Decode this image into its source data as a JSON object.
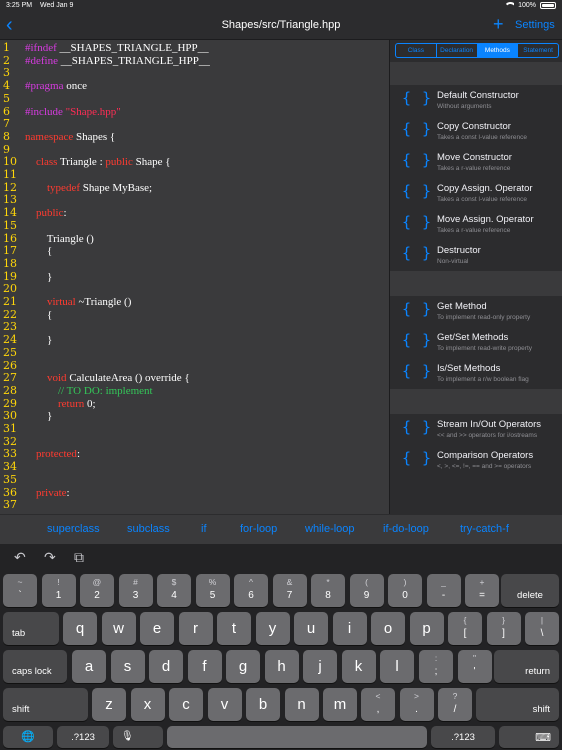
{
  "status": {
    "time": "3:25 PM",
    "date": "Wed Jan 9",
    "battery": "100%"
  },
  "nav": {
    "back_icon": "chevron-left-icon",
    "title": "Shapes/src/Triangle.hpp",
    "plus": "+",
    "settings": "Settings"
  },
  "editor": {
    "line_numbers": [
      "1",
      "2",
      "3",
      "4",
      "5",
      "6",
      "7",
      "8",
      "9",
      "10",
      "11",
      "12",
      "13",
      "14",
      "15",
      "16",
      "17",
      "18",
      "19",
      "20",
      "21",
      "22",
      "23",
      "24",
      "25",
      "26",
      "27",
      "28",
      "29",
      "30",
      "31",
      "32",
      "33",
      "34",
      "35",
      "36",
      "37"
    ],
    "lines": [
      [
        {
          "t": "#ifndef",
          "c": "kw"
        },
        {
          "t": " __SHAPES_TRIANGLE_HPP__",
          "c": ""
        }
      ],
      [
        {
          "t": "#define",
          "c": "kw"
        },
        {
          "t": " __SHAPES_TRIANGLE_HPP__",
          "c": ""
        }
      ],
      [],
      [
        {
          "t": "#pragma",
          "c": "kw"
        },
        {
          "t": " once",
          "c": ""
        }
      ],
      [],
      [
        {
          "t": "#include",
          "c": "kw"
        },
        {
          "t": " \"Shape.hpp\"",
          "c": "str"
        }
      ],
      [],
      [
        {
          "t": "namespace",
          "c": "red"
        },
        {
          "t": " Shapes {",
          "c": ""
        }
      ],
      [],
      [
        {
          "t": "    class",
          "c": "red"
        },
        {
          "t": " Triangle : ",
          "c": ""
        },
        {
          "t": "public",
          "c": "red"
        },
        {
          "t": " Shape {",
          "c": ""
        }
      ],
      [],
      [
        {
          "t": "        typedef",
          "c": "red"
        },
        {
          "t": " Shape MyBase;",
          "c": ""
        }
      ],
      [],
      [
        {
          "t": "    public",
          "c": "red"
        },
        {
          "t": ":",
          "c": ""
        }
      ],
      [],
      [
        {
          "t": "        Triangle ()",
          "c": ""
        }
      ],
      [
        {
          "t": "        {",
          "c": ""
        }
      ],
      [],
      [
        {
          "t": "        }",
          "c": ""
        }
      ],
      [],
      [
        {
          "t": "        virtual",
          "c": "red"
        },
        {
          "t": " ~Triangle ()",
          "c": ""
        }
      ],
      [
        {
          "t": "        {",
          "c": ""
        }
      ],
      [],
      [
        {
          "t": "        }",
          "c": ""
        }
      ],
      [],
      [],
      [
        {
          "t": "        void",
          "c": "red"
        },
        {
          "t": " CalculateArea () override {",
          "c": ""
        }
      ],
      [
        {
          "t": "            // TO DO: implement",
          "c": "grn"
        }
      ],
      [
        {
          "t": "            return",
          "c": "red"
        },
        {
          "t": " 0;",
          "c": ""
        }
      ],
      [
        {
          "t": "        }",
          "c": ""
        }
      ],
      [],
      [],
      [
        {
          "t": "    protected",
          "c": "red"
        },
        {
          "t": ":",
          "c": ""
        }
      ],
      [],
      [],
      [
        {
          "t": "    private",
          "c": "red"
        },
        {
          "t": ":",
          "c": ""
        }
      ]
    ]
  },
  "panel": {
    "tabs": [
      {
        "label": "Class",
        "active": false
      },
      {
        "label": "Declaration",
        "active": false
      },
      {
        "label": "Methods",
        "active": true
      },
      {
        "label": "Statement",
        "active": false
      }
    ],
    "brace_icon": "{ }",
    "groups": [
      [
        {
          "title": "Default Constructor",
          "subtitle": "Without arguments"
        },
        {
          "title": "Copy Constructor",
          "subtitle": "Takes a const l-value reference"
        },
        {
          "title": "Move Constructor",
          "subtitle": "Takes a r-value reference"
        },
        {
          "title": "Copy Assign. Operator",
          "subtitle": "Takes a const l-value reference"
        },
        {
          "title": "Move Assign. Operator",
          "subtitle": "Takes a r-value reference"
        },
        {
          "title": "Destructor",
          "subtitle": "Non-virtual"
        }
      ],
      [
        {
          "title": "Get Method",
          "subtitle": "To implement read-only property"
        },
        {
          "title": "Get/Set Methods",
          "subtitle": "To implement read-write property"
        },
        {
          "title": "Is/Set Methods",
          "subtitle": "To implement a r/w boolean flag"
        }
      ],
      [
        {
          "title": "Stream In/Out Operators",
          "subtitle": "<< and >> operators for i/ostreams"
        },
        {
          "title": "Comparison Operators",
          "subtitle": "<, >, <=, !=, == and >= operators"
        }
      ]
    ]
  },
  "snippets": [
    "superclass",
    "subclass",
    "if",
    "for-loop",
    "while-loop",
    "if-do-loop",
    "try-catch-f"
  ],
  "keyboard": {
    "toolbar": {
      "undo": "↶",
      "redo": "↷",
      "paste": "⧉"
    },
    "row1": [
      {
        "top": "~",
        "bot": "`"
      },
      {
        "top": "!",
        "bot": "1"
      },
      {
        "top": "@",
        "bot": "2"
      },
      {
        "top": "#",
        "bot": "3"
      },
      {
        "top": "$",
        "bot": "4"
      },
      {
        "top": "%",
        "bot": "5"
      },
      {
        "top": "^",
        "bot": "6"
      },
      {
        "top": "&",
        "bot": "7"
      },
      {
        "top": "*",
        "bot": "8"
      },
      {
        "top": "(",
        "bot": "9"
      },
      {
        "top": ")",
        "bot": "0"
      },
      {
        "top": "_",
        "bot": "-"
      },
      {
        "top": "+",
        "bot": "="
      }
    ],
    "delete": "delete",
    "tab": "tab",
    "row2": [
      "q",
      "w",
      "e",
      "r",
      "t",
      "y",
      "u",
      "i",
      "o",
      "p"
    ],
    "row2b": [
      {
        "top": "{",
        "bot": "["
      },
      {
        "top": "}",
        "bot": "]"
      },
      {
        "top": "|",
        "bot": "\\"
      }
    ],
    "caps": "caps lock",
    "row3": [
      "a",
      "s",
      "d",
      "f",
      "g",
      "h",
      "j",
      "k",
      "l"
    ],
    "row3b": [
      {
        "top": ":",
        "bot": ";"
      },
      {
        "top": "\"",
        "bot": "'"
      }
    ],
    "return": "return",
    "shift": "shift",
    "row4": [
      "z",
      "x",
      "c",
      "v",
      "b",
      "n",
      "m"
    ],
    "row4b": [
      {
        "top": "<",
        "bot": ","
      },
      {
        "top": ">",
        "bot": "."
      },
      {
        "top": "?",
        "bot": "/"
      }
    ],
    "num": ".?123",
    "globe_icon": "globe-icon",
    "mic_icon": "mic-icon",
    "dismiss_icon": "keyboard-dismiss-icon"
  }
}
